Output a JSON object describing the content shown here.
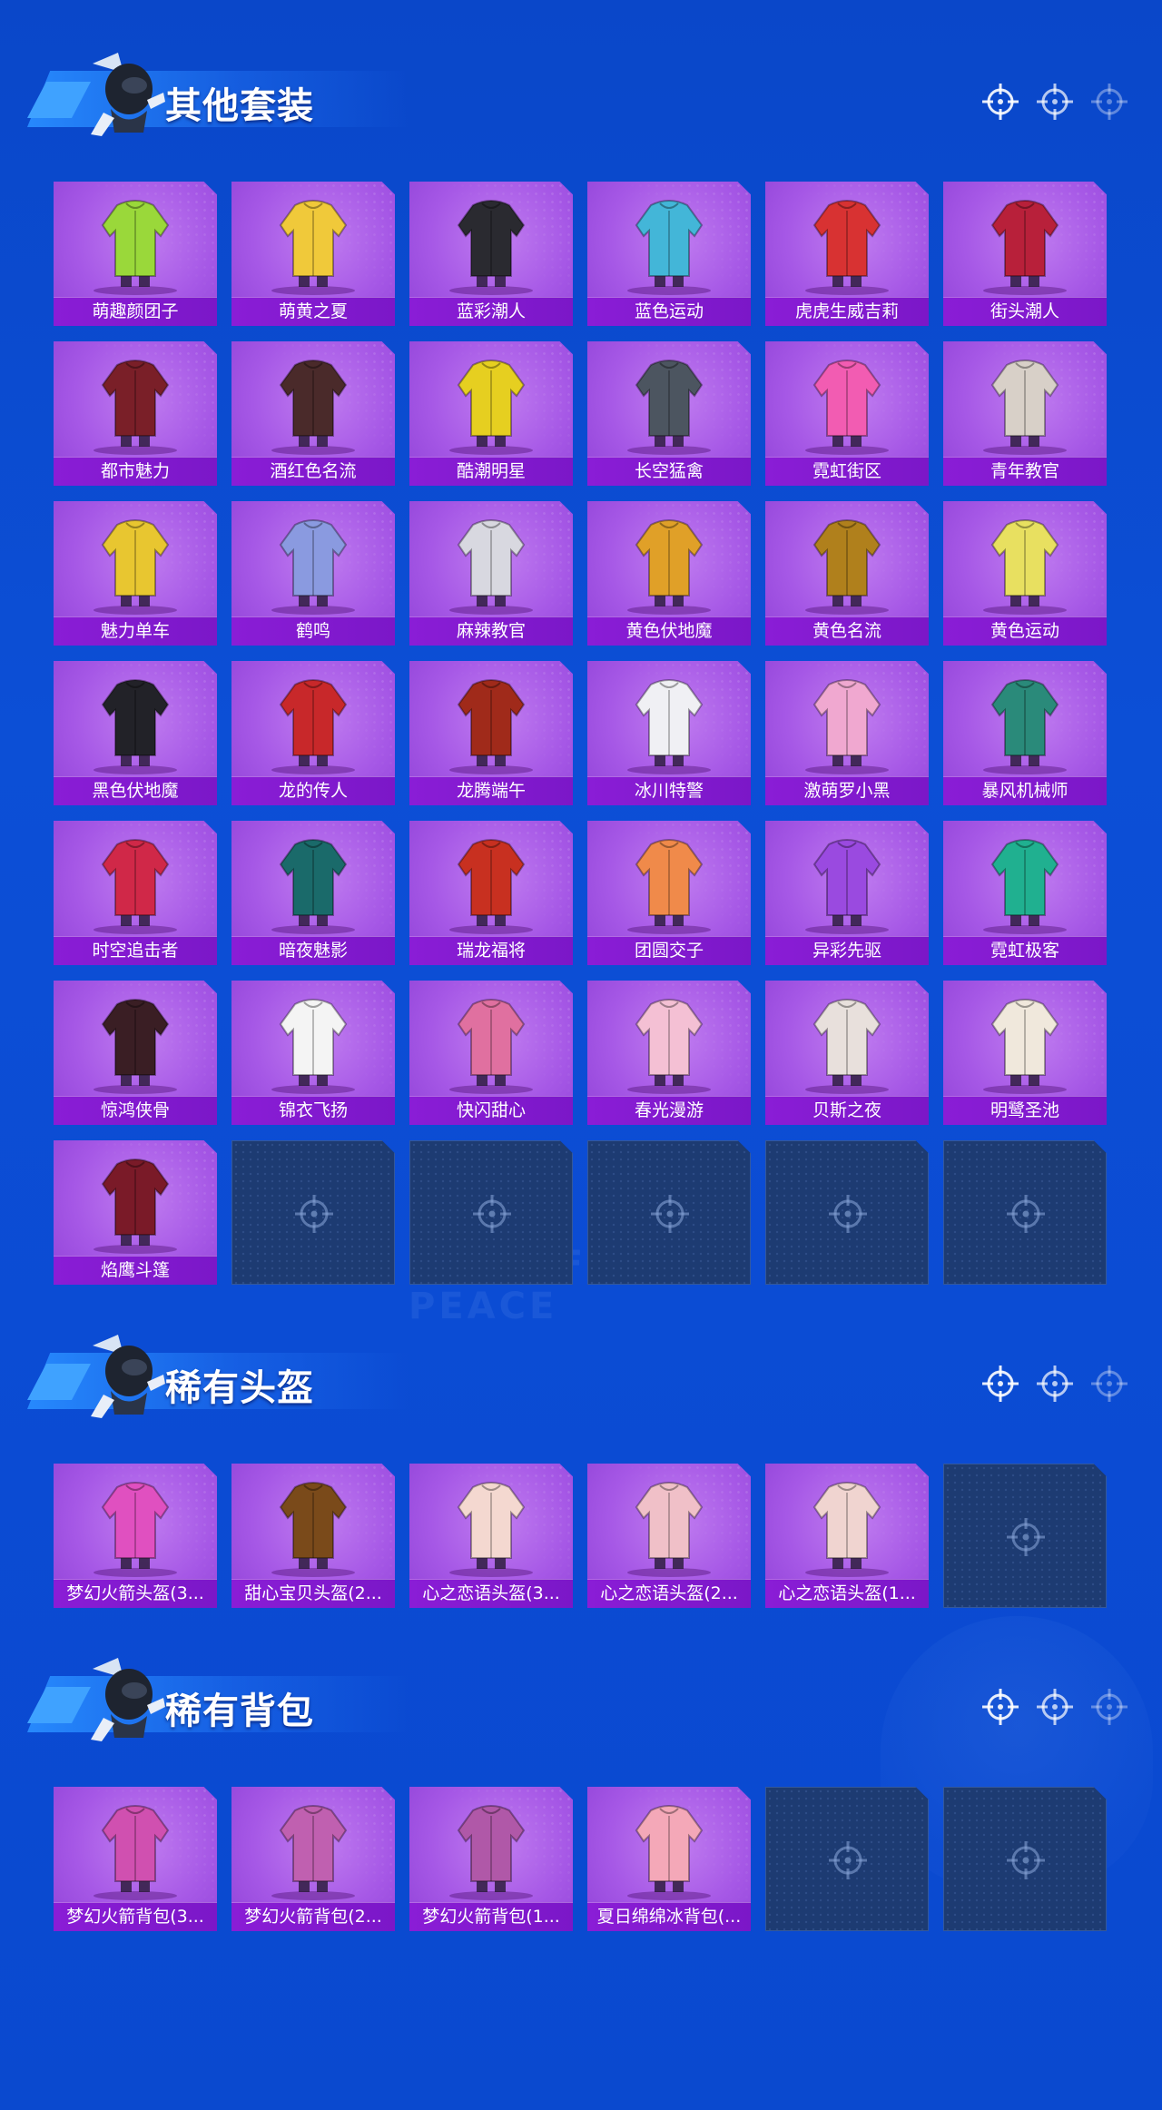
{
  "sections": [
    {
      "title": "其他套装",
      "items": [
        {
          "label": "萌趣颜团子",
          "color": "#9ad83a"
        },
        {
          "label": "萌黄之夏",
          "color": "#f0c93a"
        },
        {
          "label": "蓝彩潮人",
          "color": "#2a2a30"
        },
        {
          "label": "蓝色运动",
          "color": "#43b6d8"
        },
        {
          "label": "虎虎生威吉莉",
          "color": "#d83232"
        },
        {
          "label": "街头潮人",
          "color": "#b8203a"
        },
        {
          "label": "都市魅力",
          "color": "#7a1f28"
        },
        {
          "label": "酒红色名流",
          "color": "#4a2a2a"
        },
        {
          "label": "酷潮明星",
          "color": "#e6cf20"
        },
        {
          "label": "长空猛禽",
          "color": "#4c5560"
        },
        {
          "label": "霓虹街区",
          "color": "#f25cb2"
        },
        {
          "label": "青年教官",
          "color": "#d8d0c8"
        },
        {
          "label": "魅力单车",
          "color": "#e8c630"
        },
        {
          "label": "鹤鸣",
          "color": "#8a9ae0"
        },
        {
          "label": "麻辣教官",
          "color": "#d8d8e0"
        },
        {
          "label": "黄色伏地魔",
          "color": "#e0a028"
        },
        {
          "label": "黄色名流",
          "color": "#b0801c"
        },
        {
          "label": "黄色运动",
          "color": "#e8e060"
        },
        {
          "label": "黑色伏地魔",
          "color": "#222228"
        },
        {
          "label": "龙的传人",
          "color": "#c8282a"
        },
        {
          "label": "龙腾端午",
          "color": "#a02a1a"
        },
        {
          "label": "冰川特警",
          "color": "#f0f0f4"
        },
        {
          "label": "激萌罗小黑",
          "color": "#f0a8d0"
        },
        {
          "label": "暴风机械师",
          "color": "#2a8a7a"
        },
        {
          "label": "时空追击者",
          "color": "#d02848"
        },
        {
          "label": "暗夜魅影",
          "color": "#1a6a6a"
        },
        {
          "label": "瑞龙福将",
          "color": "#c83020"
        },
        {
          "label": "团圆交子",
          "color": "#f08a4a"
        },
        {
          "label": "异彩先驱",
          "color": "#9a4ae0"
        },
        {
          "label": "霓虹极客",
          "color": "#20b090"
        },
        {
          "label": "惊鸿侠骨",
          "color": "#3a1e24"
        },
        {
          "label": "锦衣飞扬",
          "color": "#f4f4f4"
        },
        {
          "label": "快闪甜心",
          "color": "#e070a0"
        },
        {
          "label": "春光漫游",
          "color": "#f4c0d4"
        },
        {
          "label": "贝斯之夜",
          "color": "#e8e0dc"
        },
        {
          "label": "明鹭圣池",
          "color": "#f0e8dc"
        },
        {
          "label": "焰鹰斗篷",
          "color": "#7a1a28"
        }
      ],
      "empty_slots": 5
    },
    {
      "title": "稀有头盔",
      "items": [
        {
          "label": "梦幻火箭头盔(3...",
          "color": "#e050c0"
        },
        {
          "label": "甜心宝贝头盔(2...",
          "color": "#7a4a1a"
        },
        {
          "label": "心之恋语头盔(3...",
          "color": "#f4d8d0"
        },
        {
          "label": "心之恋语头盔(2...",
          "color": "#f0c0c8"
        },
        {
          "label": "心之恋语头盔(1...",
          "color": "#f0d4d0"
        }
      ],
      "empty_slots": 1
    },
    {
      "title": "稀有背包",
      "items": [
        {
          "label": "梦幻火箭背包(3...",
          "color": "#d050b0"
        },
        {
          "label": "梦幻火箭背包(2...",
          "color": "#c060b0"
        },
        {
          "label": "梦幻火箭背包(1...",
          "color": "#b058a8"
        },
        {
          "label": "夏日绵绵冰背包(...",
          "color": "#f4a8b8"
        }
      ],
      "empty_slots": 2
    }
  ],
  "watermark": "GAME FOR PEACE"
}
